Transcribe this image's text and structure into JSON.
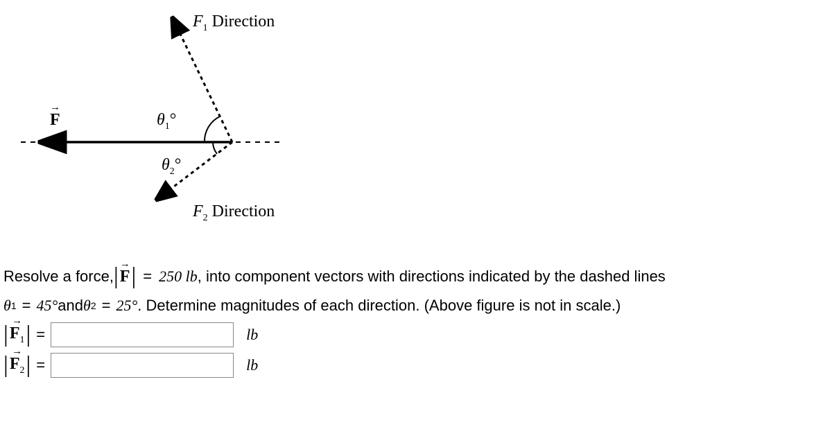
{
  "diagram": {
    "f_label": "F",
    "f1_direction": "F₁ Direction",
    "f2_direction": "F₂ Direction",
    "theta1": "θ₁°",
    "theta2": "θ₂°"
  },
  "problem": {
    "text1_a": "Resolve a force, ",
    "force_magnitude": "250",
    "text1_b": ", into component vectors with directions indicated by the dashed lines",
    "text2_a": " and ",
    "theta1_val": "45°",
    "theta2_val": "25°",
    "text2_b": ". Determine magnitudes of each direction. (Above figure is not in scale.)",
    "unit": "lb"
  },
  "chart_data": {
    "type": "diagram",
    "force_given": {
      "symbol": "F",
      "magnitude": 250,
      "unit": "lb"
    },
    "angles": {
      "theta1": 45,
      "theta2": 25,
      "unit": "degrees"
    },
    "unknowns": [
      "|F1|",
      "|F2|"
    ],
    "note": "F is resultant along negative x-axis; F1 Direction is upper-left dashed ray at theta1 above axis; F2 Direction is lower-left dashed ray at theta2 below axis"
  }
}
